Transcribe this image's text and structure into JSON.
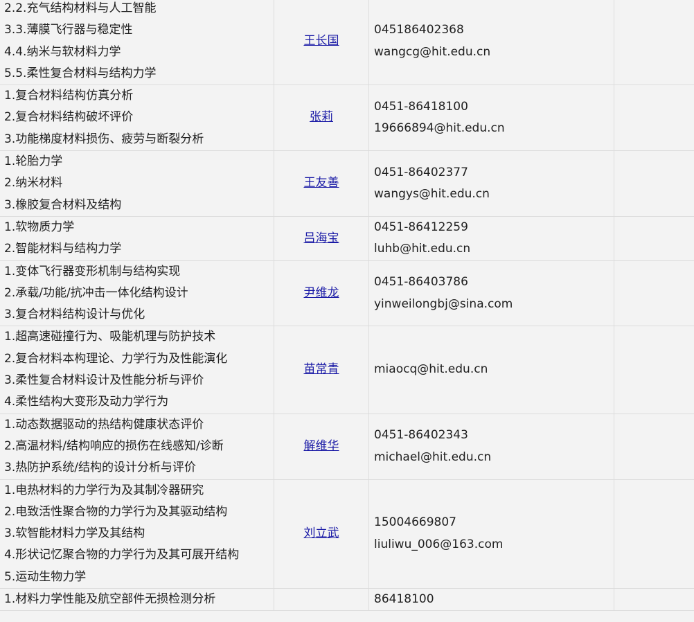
{
  "rows": [
    {
      "directions": [
        "2.2.充气结构材料与人工智能",
        "3.3.薄膜飞行器与稳定性",
        "4.4.纳米与软材料力学",
        "5.5.柔性复合材料与结构力学"
      ],
      "name": "王长国",
      "phone": "045186402368",
      "email": "wangcg@hit.edu.cn"
    },
    {
      "directions": [
        "1.复合材料结构仿真分析",
        "2.复合材料结构破坏评价",
        "3.功能梯度材料损伤、疲劳与断裂分析"
      ],
      "name": "张莉",
      "phone": "0451-86418100",
      "email": "19666894@hit.edu.cn"
    },
    {
      "directions": [
        "1.轮胎力学",
        "2.纳米材料",
        "3.橡胶复合材料及结构"
      ],
      "name": "王友善",
      "phone": "0451-86402377",
      "email": "wangys@hit.edu.cn"
    },
    {
      "directions": [
        "1.软物质力学",
        "2.智能材料与结构力学"
      ],
      "name": "吕海宝",
      "phone": "0451-86412259",
      "email": "luhb@hit.edu.cn"
    },
    {
      "directions": [
        "1.变体飞行器变形机制与结构实现",
        "2.承载/功能/抗冲击一体化结构设计",
        "3.复合材料结构设计与优化"
      ],
      "name": "尹维龙",
      "phone": "0451-86403786",
      "email": "yinweilongbj@sina.com"
    },
    {
      "directions": [
        "1.超高速碰撞行为、吸能机理与防护技术",
        "2.复合材料本构理论、力学行为及性能演化",
        "3.柔性复合材料设计及性能分析与评价",
        "4.柔性结构大变形及动力学行为"
      ],
      "name": "苗常青",
      "phone": "",
      "email": "miaocq@hit.edu.cn"
    },
    {
      "directions": [
        "1.动态数据驱动的热结构健康状态评价",
        "2.高温材料/结构响应的损伤在线感知/诊断",
        "3.热防护系统/结构的设计分析与评价"
      ],
      "name": "解维华",
      "phone": "0451-86402343",
      "email": "michael@hit.edu.cn"
    },
    {
      "directions": [
        "1.电热材料的力学行为及其制冷器研究",
        "2.电致活性聚合物的力学行为及其驱动结构",
        "3.软智能材料力学及其结构",
        "4.形状记忆聚合物的力学行为及其可展开结构",
        "5.运动生物力学"
      ],
      "name": "刘立武",
      "phone": "15004669807",
      "email": "liuliwu_006@163.com"
    },
    {
      "directions": [
        "1.材料力学性能及航空部件无损检测分析"
      ],
      "name": "",
      "phone": "86418100",
      "email": ""
    }
  ]
}
